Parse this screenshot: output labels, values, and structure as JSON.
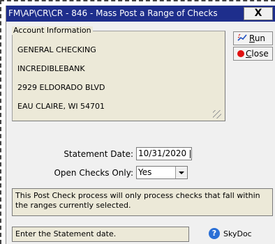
{
  "window": {
    "title": "FM\\AP\\CR\\CR - 846 - Mass Post a Range of Checks",
    "close_glyph": "X"
  },
  "account_info": {
    "legend": "Account Information",
    "lines": [
      "GENERAL CHECKING",
      "INCREDIBLEBANK",
      "2929 ELDORADO BLVD",
      "EAU CLAIRE, WI 54701"
    ]
  },
  "buttons": {
    "run": {
      "accel": "R",
      "rest": "un"
    },
    "close": {
      "accel": "C",
      "rest": "lose"
    }
  },
  "form": {
    "statement_date_label": "Statement Date:",
    "statement_date_value": "10/31/2020",
    "open_checks_label": "Open Checks Only:",
    "open_checks_value": "Yes"
  },
  "info_message": "This Post Check process will only process checks that fall within the ranges currently selected.",
  "status_text": "Enter the Statement date.",
  "help": {
    "icon_glyph": "?",
    "label": "SkyDoc"
  },
  "colors": {
    "titlebar": "#1e2e8c",
    "close_dot": "#e01010",
    "help_icon": "#2a6fd6"
  }
}
